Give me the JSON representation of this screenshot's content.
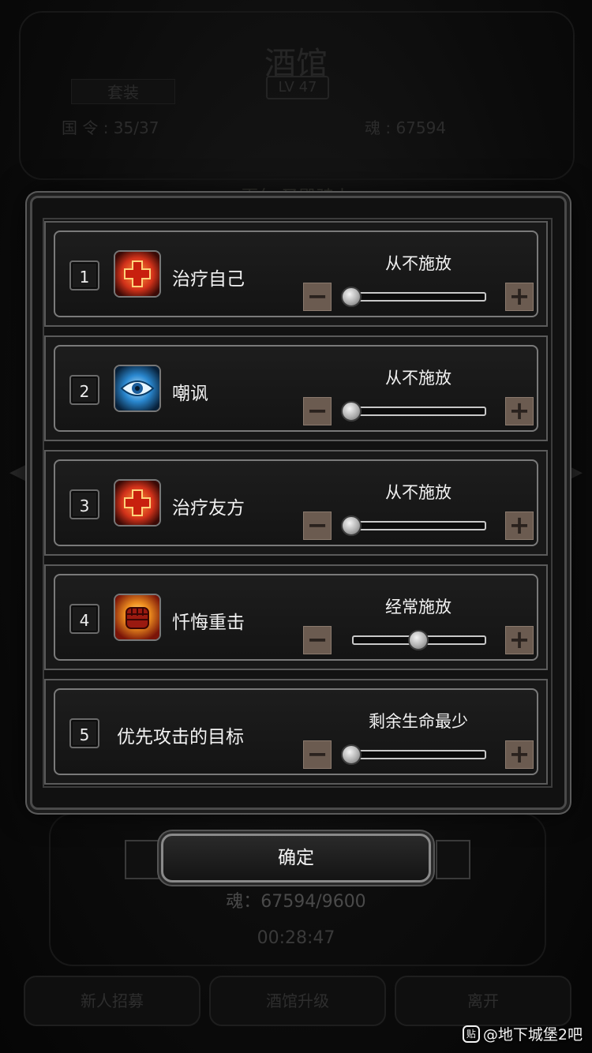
{
  "background": {
    "title": "酒馆",
    "level": "LV 47",
    "tab": "套装",
    "stat_left": "国 令 : 35/37",
    "stat_right": "魂 : 67594",
    "hero_name": "夏尔 圣殿骑士",
    "soul": "魂：67594/9600",
    "timer": "00:28:47",
    "buttons": [
      "新人招募",
      "酒馆升级",
      "离开"
    ]
  },
  "skills": [
    {
      "index": "1",
      "name": "治疗自己",
      "mode": "从不施放",
      "level": 0,
      "icon": "heal-cross-icon"
    },
    {
      "index": "2",
      "name": "嘲讽",
      "mode": "从不施放",
      "level": 0,
      "icon": "eye-icon"
    },
    {
      "index": "3",
      "name": "治疗友方",
      "mode": "从不施放",
      "level": 0,
      "icon": "heal-cross-icon"
    },
    {
      "index": "4",
      "name": "忏悔重击",
      "mode": "经常施放",
      "level": 0.5,
      "icon": "fist-icon"
    },
    {
      "index": "5",
      "name": "优先攻击的目标",
      "mode": "剩余生命最少",
      "level": 0,
      "icon": null
    }
  ],
  "controls": {
    "minus": "−",
    "plus": "+"
  },
  "confirm_label": "确定",
  "watermark": {
    "logo": "贴",
    "text": "@地下城堡2吧"
  },
  "colors": {
    "step_button": "#6b5b50",
    "heal_icon": "#e0441c",
    "eye_icon": "#2a88d0",
    "fist_icon": "#d9501e"
  }
}
